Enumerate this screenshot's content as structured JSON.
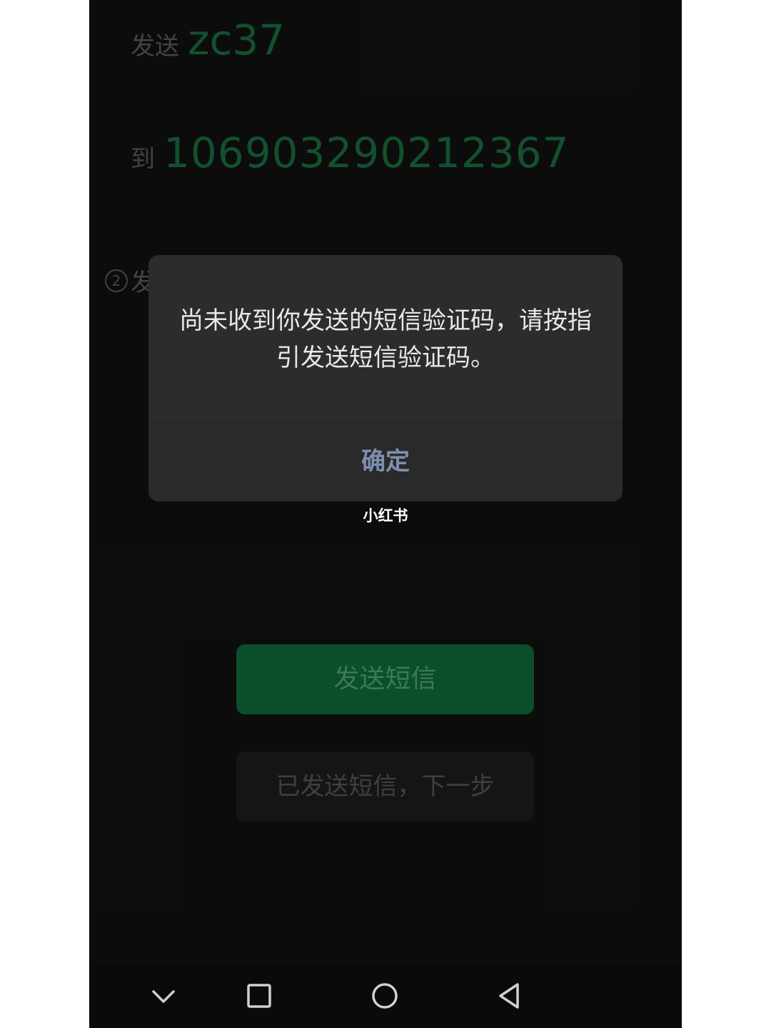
{
  "instructions": {
    "send_prefix": "发送",
    "send_code": "zc37",
    "to_prefix": "到",
    "to_number": "106903290212367",
    "step2_num": "2",
    "step2_label": "发"
  },
  "dialog": {
    "message": "尚未收到你发送的短信验证码，请按指引发送短信验证码。",
    "confirm_label": "确定"
  },
  "watermark": "小红书",
  "buttons": {
    "send_sms": "发送短信",
    "sent_next": "已发送短信，下一步"
  },
  "navbar": {
    "icons": [
      "chevron-down-icon",
      "recent-apps-icon",
      "home-icon",
      "back-icon"
    ]
  },
  "colors": {
    "accent_green": "#0e6a38",
    "code_green": "#1a6b3e",
    "confirm_blue": "#7d90b0"
  }
}
